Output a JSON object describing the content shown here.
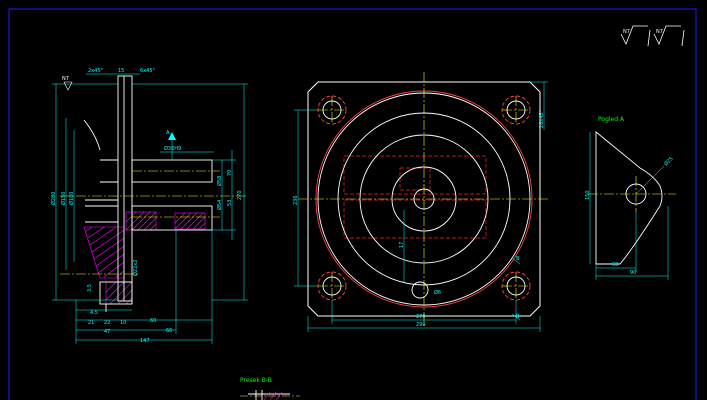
{
  "drawing": {
    "border_color": "#1c1cff",
    "colors": {
      "outline": "#ffffff",
      "dimension": "#00ffff",
      "centerline": "#ffff00",
      "hidden": "#ff2020",
      "hatch": "#ff00ff",
      "label": "#00ff00"
    },
    "surface_symbols": [
      "N7",
      "N7"
    ],
    "side_view": {
      "dims_top": [
        "2x45°",
        "15",
        "6x45°"
      ],
      "finish_mark": "N7",
      "section_arrow": "A",
      "bore_label": "Ø36H9",
      "dims_left": [
        "Ø280",
        "Ø150",
        "Ø180"
      ],
      "dims_right": [
        "Ø58",
        "Ø54",
        "70",
        "53",
        "270"
      ],
      "dims_inner": [
        "Ø22x2",
        "3.5"
      ],
      "dims_bottom": [
        "4.5",
        "21",
        "22",
        "10",
        "60",
        "47",
        "66",
        "147"
      ]
    },
    "front_view": {
      "dims": [
        "236",
        "270",
        "290",
        "26x45°",
        "17",
        "Ø6"
      ],
      "section_mark": "B"
    },
    "detail_view": {
      "title": "Pogled A",
      "dims": [
        "Ø25",
        "150",
        "60",
        "90"
      ]
    },
    "section_view": {
      "title": "Presek B-B"
    }
  }
}
